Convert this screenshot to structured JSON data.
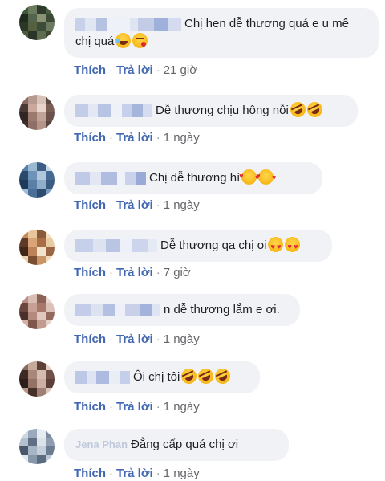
{
  "comments": [
    {
      "name": "",
      "text": "Chị hen dễ thương quá e u mê chị quá",
      "emojis": [
        "laugh",
        "kiss"
      ],
      "like_label": "Thích",
      "reply_label": "Trả lời",
      "time": "21 giờ"
    },
    {
      "name": "",
      "text": "Dễ thương chịu hông nỗi",
      "emojis": [
        "rofl",
        "rofl"
      ],
      "like_label": "Thích",
      "reply_label": "Trả lời",
      "time": "1 ngày"
    },
    {
      "name": "",
      "text": "Chị dễ thương hì",
      "emojis": [
        "hearts-face",
        "hearts-face"
      ],
      "like_label": "Thích",
      "reply_label": "Trả lời",
      "time": "1 ngày"
    },
    {
      "name": "",
      "text": "Dễ thương qa chị oi",
      "emojis": [
        "heart-eyes",
        "heart-eyes"
      ],
      "like_label": "Thích",
      "reply_label": "Trả lời",
      "time": "7 giờ"
    },
    {
      "name": "",
      "text": "n dễ thương lắm e ơi.",
      "emojis": [],
      "like_label": "Thích",
      "reply_label": "Trả lời",
      "time": "1 ngày"
    },
    {
      "name": "",
      "text": "Ôi chị tôi",
      "emojis": [
        "rofl",
        "rofl",
        "rofl"
      ],
      "like_label": "Thích",
      "reply_label": "Trả lời",
      "time": "1 ngày"
    },
    {
      "name": "Jena Phan",
      "text": "Đẳng cấp quá chị ơi",
      "emojis": [],
      "like_label": "Thích",
      "reply_label": "Trả lời",
      "time": "1 ngày"
    }
  ],
  "colors": {
    "link": "#4267b2",
    "bubble": "#f0f2f5",
    "text": "#1c1e21",
    "meta": "#65676b"
  }
}
